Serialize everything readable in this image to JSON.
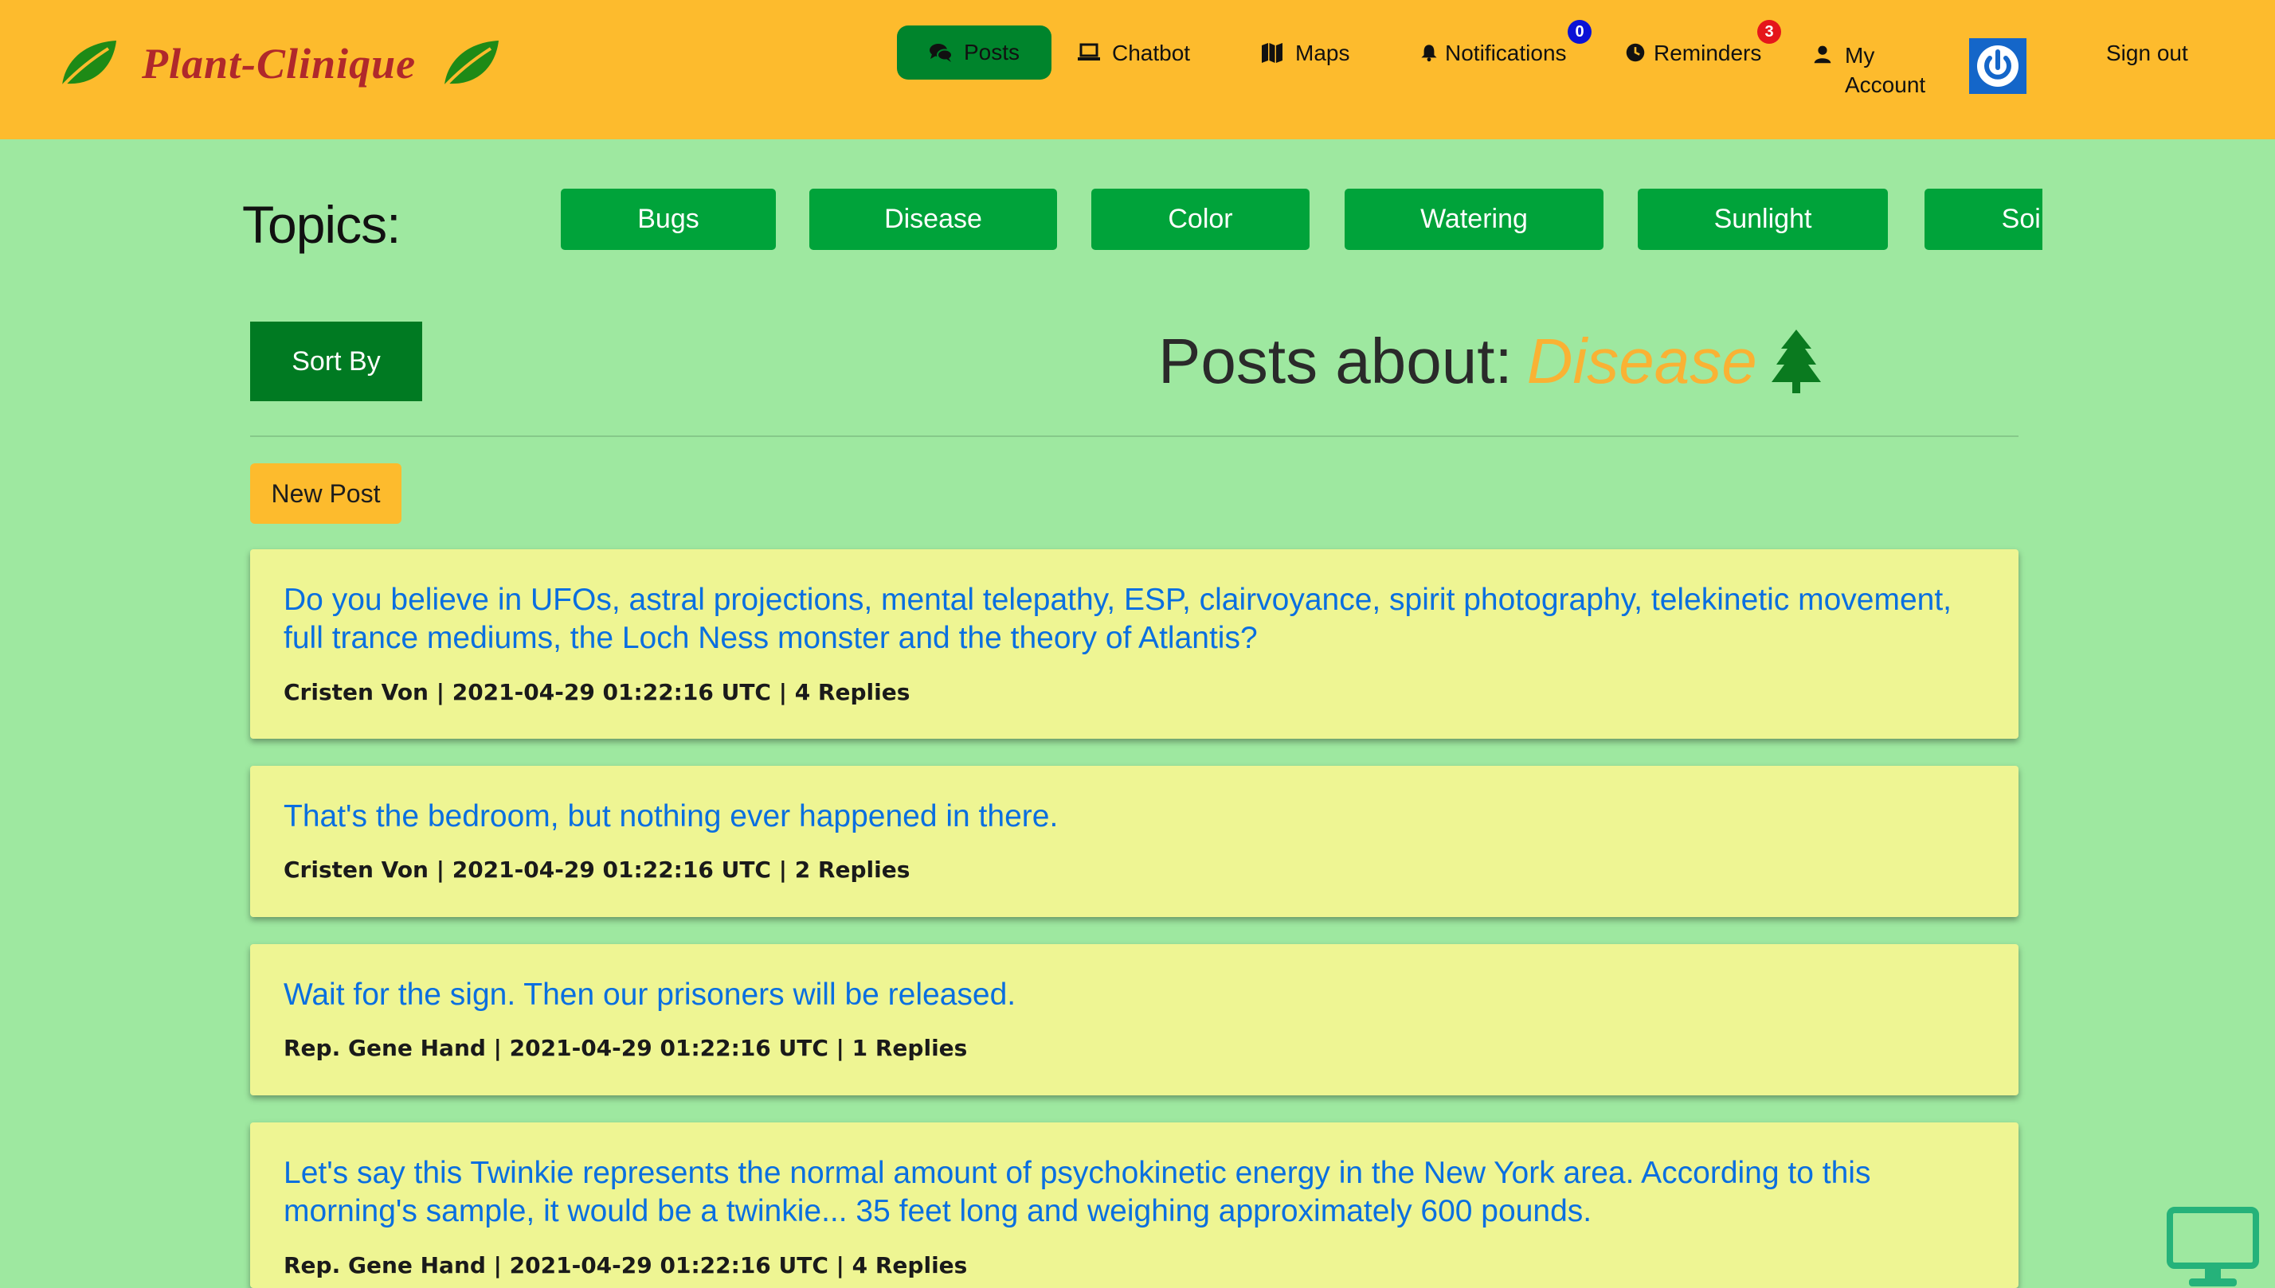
{
  "brand": {
    "name": "Plant-Clinique"
  },
  "nav": {
    "posts": "Posts",
    "chatbot": "Chatbot",
    "maps": "Maps",
    "notifications": "Notifications",
    "notifications_count": "0",
    "reminders": "Reminders",
    "reminders_count": "3",
    "my": "My",
    "account": "Account",
    "sign_out": "Sign out"
  },
  "topics": {
    "title": "Topics:",
    "items": [
      "Bugs",
      "Disease",
      "Color",
      "Watering",
      "Sunlight",
      "Soil"
    ]
  },
  "toolbar": {
    "sort_label": "Sort By",
    "new_post_label": "New Post"
  },
  "heading": {
    "prefix": "Posts about:",
    "topic": "Disease"
  },
  "posts": [
    {
      "title": "Do you believe in UFOs, astral projections, mental telepathy, ESP, clairvoyance, spirit photography, telekinetic movement, full trance mediums, the Loch Ness monster and the theory of Atlantis?",
      "meta": "Cristen Von | 2021-04-29 01:22:16 UTC | 4 Replies"
    },
    {
      "title": "That's the bedroom, but nothing ever happened in there.",
      "meta": "Cristen Von | 2021-04-29 01:22:16 UTC | 2 Replies"
    },
    {
      "title": "Wait for the sign. Then our prisoners will be released.",
      "meta": "Rep. Gene Hand | 2021-04-29 01:22:16 UTC | 1 Replies"
    },
    {
      "title": "Let's say this Twinkie represents the normal amount of psychokinetic energy in the New York area. According to this morning's sample, it would be a twinkie... 35 feet long and weighing approximately 600 pounds.",
      "meta": "Rep. Gene Hand | 2021-04-29 01:22:16 UTC | 4 Replies"
    }
  ],
  "colors": {
    "navbar": "#fdbb2d",
    "page_bg": "#9ee8a0",
    "active_nav": "#00842c",
    "topic_button": "#00a33a",
    "sort_button": "#007a22",
    "post_card": "#eef593",
    "post_title": "#0a6fe0",
    "brand_text": "#b0282b",
    "heading_topic": "#f9b234"
  },
  "icons": {
    "posts": "comments-icon",
    "chatbot": "laptop-icon",
    "maps": "map-icon",
    "notifications": "bell-icon",
    "reminders": "clock-icon",
    "account": "user-icon",
    "logout": "power-icon",
    "heading": "tree-icon",
    "corner": "desktop-icon"
  }
}
